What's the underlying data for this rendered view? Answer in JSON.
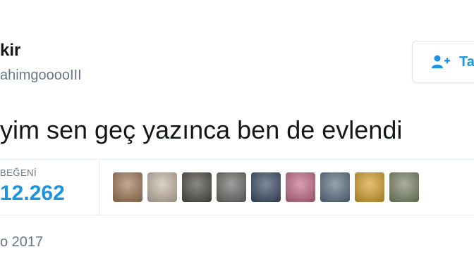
{
  "user": {
    "name": "kir",
    "handle": "ahimgooooIII"
  },
  "follow_button": {
    "label": "Ta"
  },
  "tweet": {
    "text": "yim sen geç yazınca ben de evlendi"
  },
  "stats": {
    "likes_label": "BEĞENİ",
    "likes_count": "12.262"
  },
  "likers": [
    {
      "icon": "liker-avatar-1",
      "color": "#a07a55"
    },
    {
      "icon": "liker-avatar-2",
      "color": "#c9b9a8"
    },
    {
      "icon": "liker-avatar-3",
      "color": "#4d4a42"
    },
    {
      "icon": "liker-avatar-4",
      "color": "#6c6a66"
    },
    {
      "icon": "liker-avatar-5",
      "color": "#3a4c66"
    },
    {
      "icon": "liker-avatar-6",
      "color": "#c56b86"
    },
    {
      "icon": "liker-avatar-7",
      "color": "#5c7084"
    },
    {
      "icon": "liker-avatar-8",
      "color": "#d6a02a"
    },
    {
      "icon": "liker-avatar-9",
      "color": "#7a8466"
    }
  ],
  "timestamp": {
    "date": "o 2017"
  },
  "colors": {
    "accent": "#1b95e0",
    "muted": "#657786",
    "divider": "#e6ecf0"
  }
}
